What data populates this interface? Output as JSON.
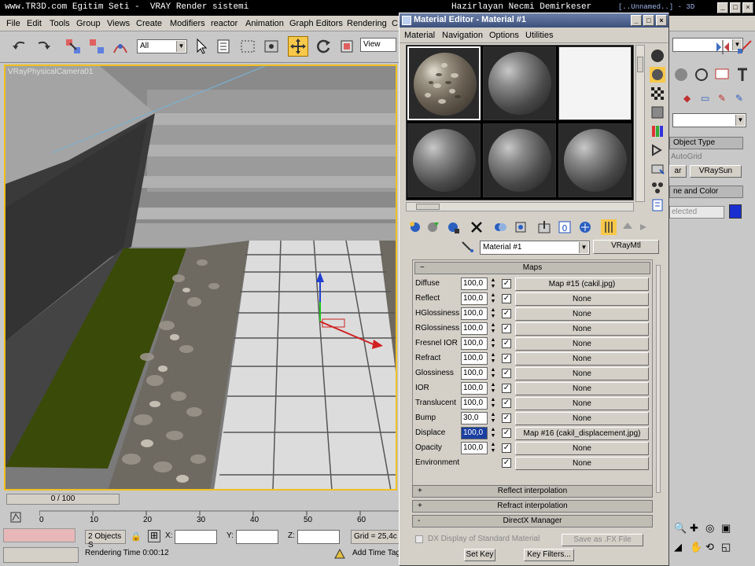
{
  "titlebar": {
    "left_text": "www.TR3D.com Egitim Seti -  VRAY Render sistemi",
    "right_text": "Hazirlayan Necmi Demirkeser",
    "app_fragment": "[..Unnamed..] - 3D",
    "min": "_",
    "max": "□",
    "close": "×"
  },
  "menubar": [
    "File",
    "Edit",
    "Tools",
    "Group",
    "Views",
    "Create",
    "Modifiers",
    "reactor",
    "Animation",
    "Graph Editors",
    "Rendering",
    "C"
  ],
  "toolbar": {
    "filter_value": "All",
    "refcoord_value": "View"
  },
  "viewport": {
    "label": "VRayPhysicalCamera01"
  },
  "timeline": {
    "frame_slider": "0 / 100",
    "ticks": [
      "0",
      "10",
      "20",
      "30",
      "40",
      "50",
      "60"
    ],
    "selection_status": "2 Objects S",
    "x_label": "X:",
    "y_label": "Y:",
    "z_label": "Z:",
    "grid_value": "Grid = 25,4c",
    "rendering_time": "Rendering Time  0:00:12",
    "add_time_tag": "Add Time Tag",
    "set_key": "Set Key",
    "key_filters": "Key Filters..."
  },
  "material_editor": {
    "title": "Material Editor - Material #1",
    "menu": [
      "Material",
      "Navigation",
      "Options",
      "Utilities"
    ],
    "material_name": "Material #1",
    "material_type": "VRayMtl",
    "maps_rollout": {
      "title": "Maps",
      "rows": [
        {
          "label": "Diffuse",
          "amount": "100,0",
          "checked": true,
          "map": "Map #15 (cakil.jpg)"
        },
        {
          "label": "Reflect",
          "amount": "100,0",
          "checked": true,
          "map": "None"
        },
        {
          "label": "HGlossiness",
          "amount": "100,0",
          "checked": true,
          "map": "None"
        },
        {
          "label": "RGlossiness",
          "amount": "100,0",
          "checked": true,
          "map": "None"
        },
        {
          "label": "Fresnel IOR",
          "amount": "100,0",
          "checked": true,
          "map": "None"
        },
        {
          "label": "Refract",
          "amount": "100,0",
          "checked": true,
          "map": "None"
        },
        {
          "label": "Glossiness",
          "amount": "100,0",
          "checked": true,
          "map": "None"
        },
        {
          "label": "IOR",
          "amount": "100,0",
          "checked": true,
          "map": "None"
        },
        {
          "label": "Translucent",
          "amount": "100,0",
          "checked": true,
          "map": "None"
        },
        {
          "label": "Bump",
          "amount": "30,0",
          "checked": true,
          "map": "None"
        },
        {
          "label": "Displace",
          "amount": "100,0",
          "checked": true,
          "map": "Map #16 (cakil_displacement.jpg)",
          "highlight": true
        },
        {
          "label": "Opacity",
          "amount": "100,0",
          "checked": true,
          "map": "None"
        },
        {
          "label": "Environment",
          "amount": "",
          "checked": true,
          "map": "None"
        }
      ]
    },
    "rollouts": [
      {
        "sign": "+",
        "title": "Reflect interpolation"
      },
      {
        "sign": "+",
        "title": "Refract interpolation"
      },
      {
        "sign": "-",
        "title": "DirectX Manager"
      }
    ],
    "dx_checkbox_label": "DX Display of Standard Material",
    "save_fx_label": "Save as .FX File"
  },
  "command_panel": {
    "object_type_header": "Object Type",
    "autogrid": "AutoGrid",
    "btn_left": "ar",
    "btn_vraysun": "VRaySun",
    "name_color_header": "ne and Color",
    "name_field": "elected",
    "color_swatch": "#1a2fd0"
  },
  "colors": {
    "active_tool": "#f7c84a",
    "viewport_border": "#f0c020",
    "grass": "#3a4a08"
  }
}
